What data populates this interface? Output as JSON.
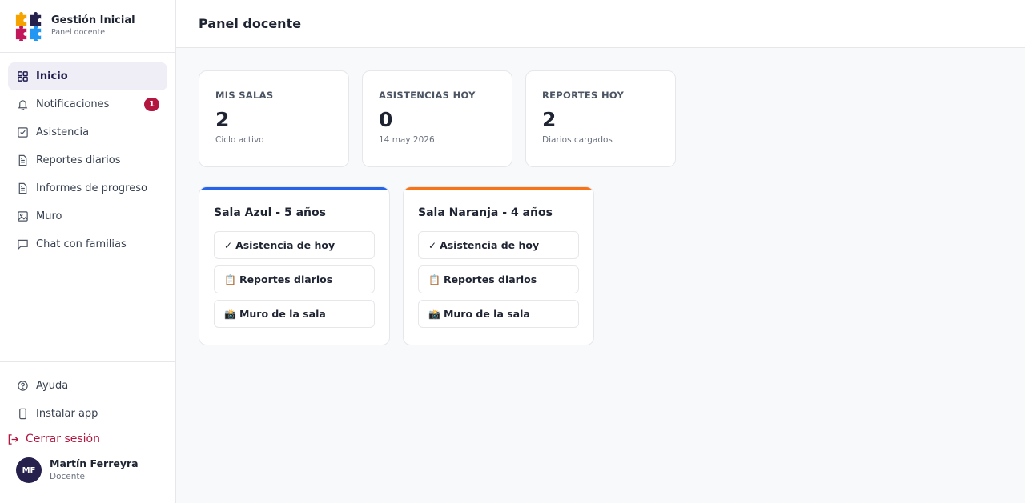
{
  "brand": {
    "title": "Gestión Inicial",
    "subtitle": "Panel docente"
  },
  "nav": {
    "items": [
      {
        "label": "Inicio",
        "icon": "grid-icon",
        "active": true
      },
      {
        "label": "Notificaciones",
        "icon": "bell-icon",
        "badge": "1"
      },
      {
        "label": "Asistencia",
        "icon": "checkbox-icon"
      },
      {
        "label": "Reportes diarios",
        "icon": "document-icon"
      },
      {
        "label": "Informes de progreso",
        "icon": "document-icon"
      },
      {
        "label": "Muro",
        "icon": "image-icon"
      },
      {
        "label": "Chat con familias",
        "icon": "chat-icon"
      }
    ]
  },
  "bottom": {
    "help": "Ayuda",
    "install": "Instalar app",
    "logout": "Cerrar sesión"
  },
  "user": {
    "initials": "MF",
    "name": "Martín Ferreyra",
    "role": "Docente"
  },
  "header": {
    "title": "Panel docente"
  },
  "stats": [
    {
      "label": "MIS SALAS",
      "value": "2",
      "sub": "Ciclo activo"
    },
    {
      "label": "ASISTENCIAS HOY",
      "value": "0",
      "sub": "14 may 2026"
    },
    {
      "label": "REPORTES HOY",
      "value": "2",
      "sub": "Diarios cargados"
    }
  ],
  "salas": [
    {
      "title": "Sala Azul - 5 años",
      "color": "#2563eb",
      "actions": [
        {
          "emoji": "✓",
          "label": "Asistencia de hoy"
        },
        {
          "emoji": "📋",
          "label": "Reportes diarios"
        },
        {
          "emoji": "📸",
          "label": "Muro de la sala"
        }
      ]
    },
    {
      "title": "Sala Naranja - 4 años",
      "color": "#f97316",
      "actions": [
        {
          "emoji": "✓",
          "label": "Asistencia de hoy"
        },
        {
          "emoji": "📋",
          "label": "Reportes diarios"
        },
        {
          "emoji": "📸",
          "label": "Muro de la sala"
        }
      ]
    }
  ],
  "colors": {
    "accent": "#26204d",
    "danger": "#b3163f",
    "active_bg": "#efeef7"
  }
}
